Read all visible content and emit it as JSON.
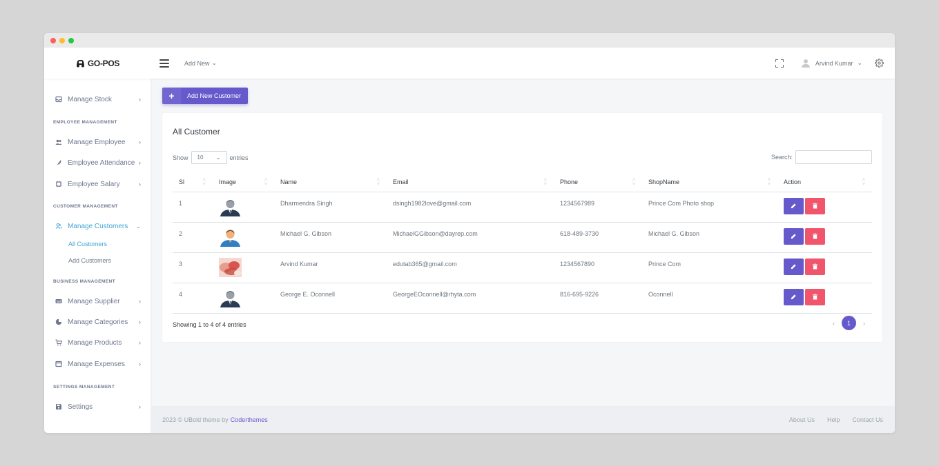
{
  "app": {
    "logo": "GO-POS"
  },
  "topbar": {
    "add_new": "Add New",
    "user_name": "Arvind Kumar"
  },
  "sidebar": {
    "manage_stock": "Manage Stock",
    "employee_section": "EMPLOYEE MANAGEMENT",
    "manage_employee": "Manage Employee",
    "employee_attendance": "Employee Attendance",
    "employee_salary": "Employee Salary",
    "customer_section": "CUSTOMER MANAGEMENT",
    "manage_customers": "Manage Customers",
    "all_customers": "All Customers",
    "add_customers": "Add Customers",
    "business_section": "BUSINESS MANAGEMENT",
    "manage_supplier": "Manage Supplier",
    "manage_categories": "Manage Categories",
    "manage_products": "Manage Products",
    "manage_expenses": "Manage Expenses",
    "settings_section": "SETTINGS MANAGEMENT",
    "settings": "Settings"
  },
  "main": {
    "add_button": "Add New Customer",
    "card_title": "All Customer",
    "show_label": "Show",
    "entries_value": "10",
    "entries_label": "entries",
    "search_label": "Search:",
    "columns": {
      "sl": "Sl",
      "image": "Image",
      "name": "Name",
      "email": "Email",
      "phone": "Phone",
      "shop": "ShopName",
      "action": "Action"
    },
    "rows": [
      {
        "sl": "1",
        "name": "Dharmendra Singh",
        "email": "dsingh1982love@gmail.com",
        "phone": "1234567989",
        "shop": "Prince Com Photo shop"
      },
      {
        "sl": "2",
        "name": "Michael G. Gibson",
        "email": "MichaelGGibson@dayrep.com",
        "phone": "618-489-3730",
        "shop": "Michael G. Gibson"
      },
      {
        "sl": "3",
        "name": "Arvind Kumar",
        "email": "edutab365@gmail.com",
        "phone": "1234567890",
        "shop": "Prince Com"
      },
      {
        "sl": "4",
        "name": "George E. Oconnell",
        "email": "GeorgeEOconnell@rhyta.com",
        "phone": "816-695-9226",
        "shop": "Oconnell"
      }
    ],
    "showing": "Showing 1 to 4 of 4 entries",
    "pager": {
      "prev": "‹",
      "page": "1",
      "next": "›"
    }
  },
  "footer": {
    "copyright": "2023 © UBold theme by",
    "brand": "Coderthemes",
    "links": {
      "about": "About Us",
      "help": "Help",
      "contact": "Contact Us"
    }
  },
  "colors": {
    "primary": "#6559cc",
    "danger": "#f1556c",
    "active": "#3ea4d3"
  }
}
